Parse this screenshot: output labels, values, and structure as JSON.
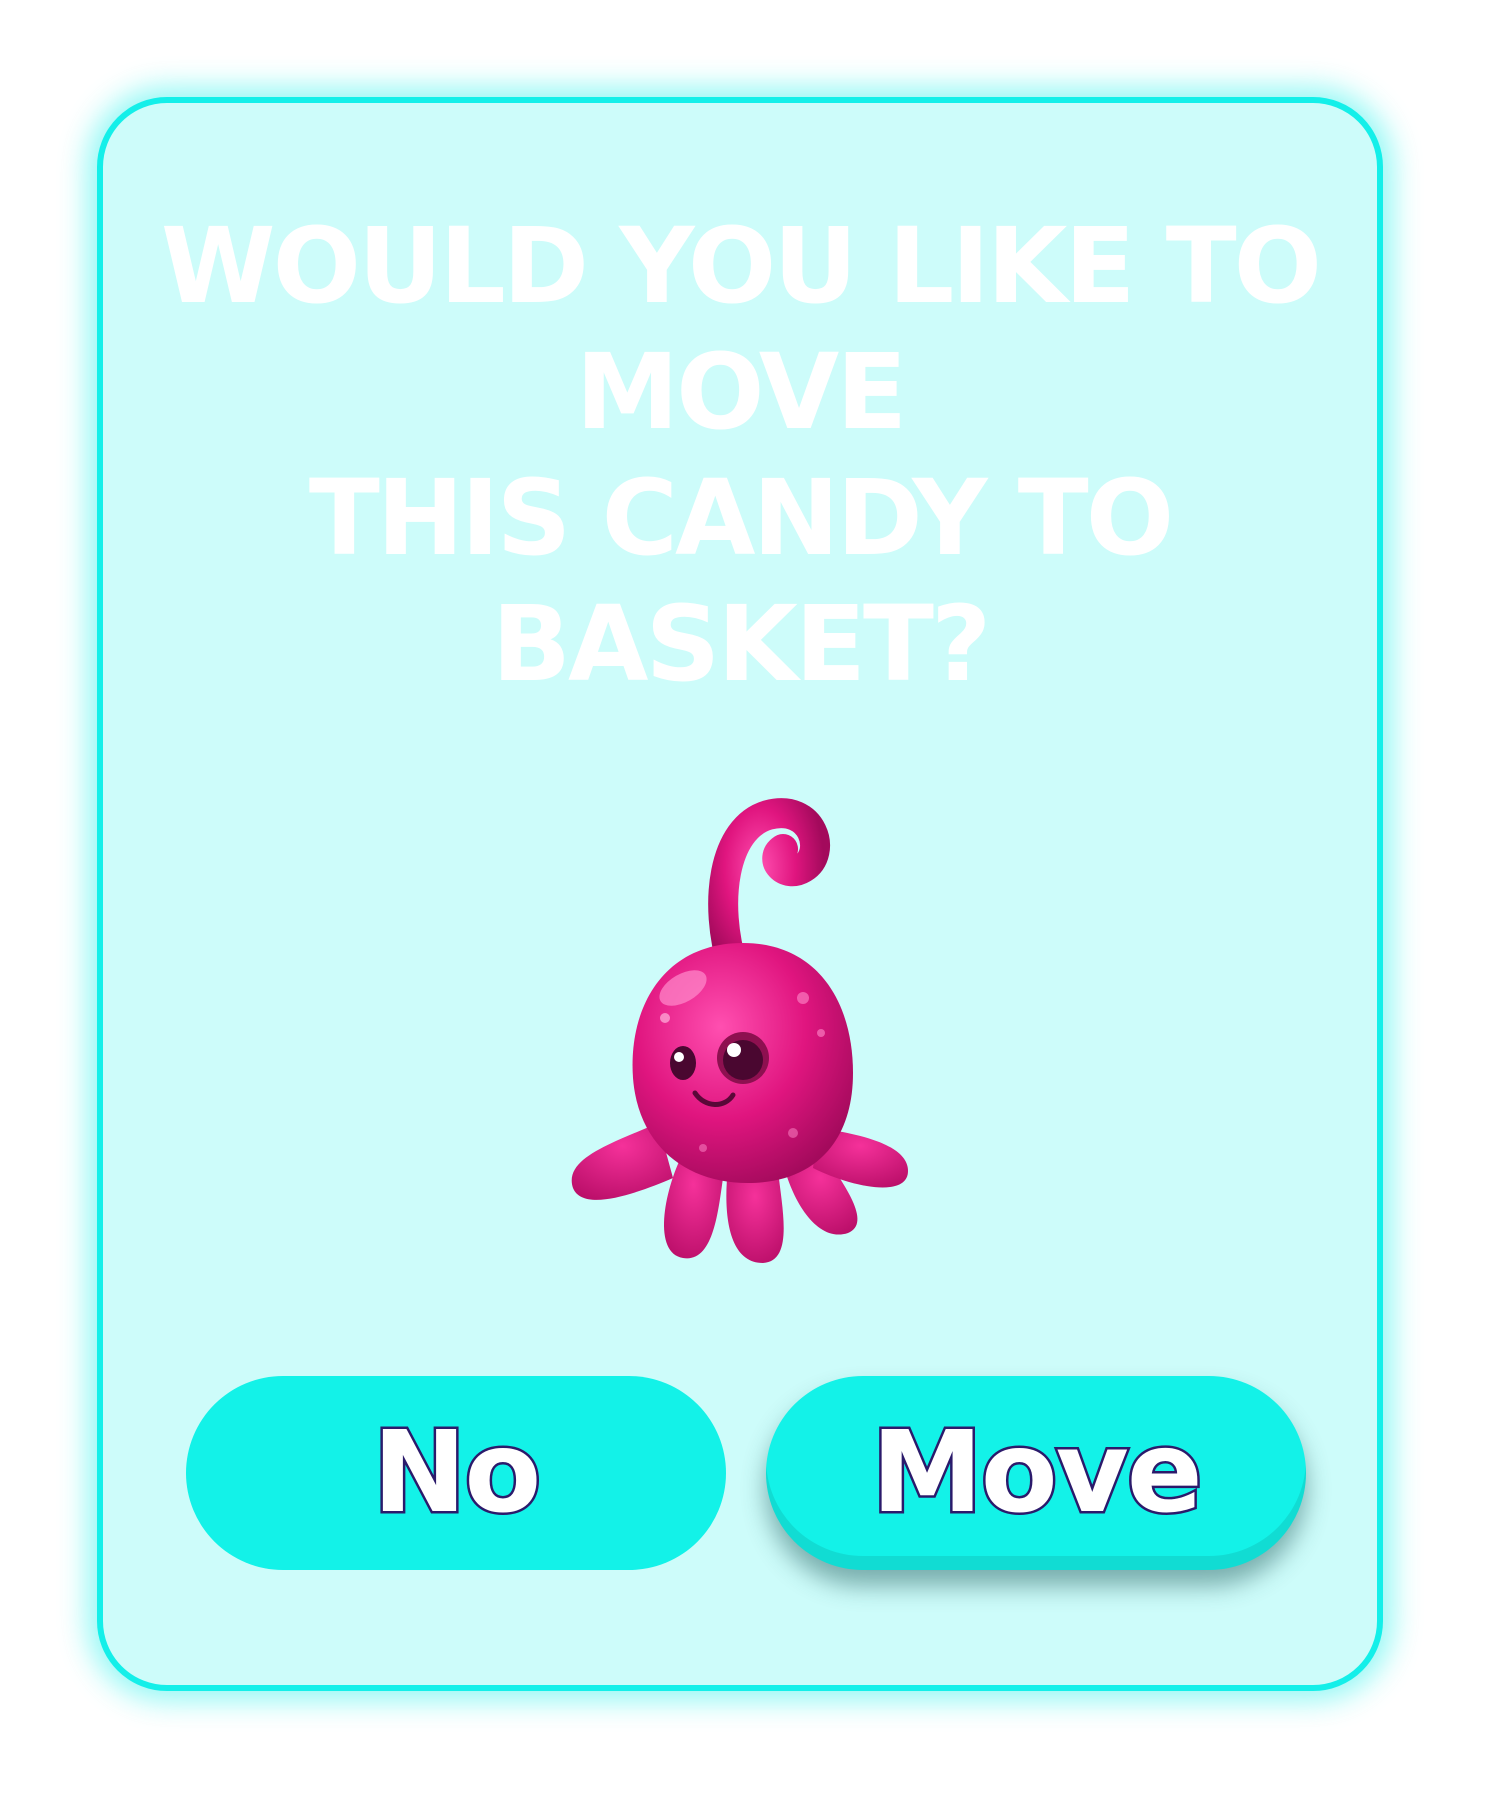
{
  "dialog": {
    "title_lines": [
      "Would you like to",
      "move",
      "this candy to",
      "basket?"
    ],
    "candy_icon": "pink-octopus-candy-icon",
    "buttons": {
      "no_label": "No",
      "move_label": "Move"
    }
  },
  "colors": {
    "panel_bg": "#cdfcfa",
    "panel_border": "#14efe9",
    "button_bg": "#13f2e8",
    "label_outline": "#2b1a6b",
    "candy_pink": "#e0157f"
  }
}
